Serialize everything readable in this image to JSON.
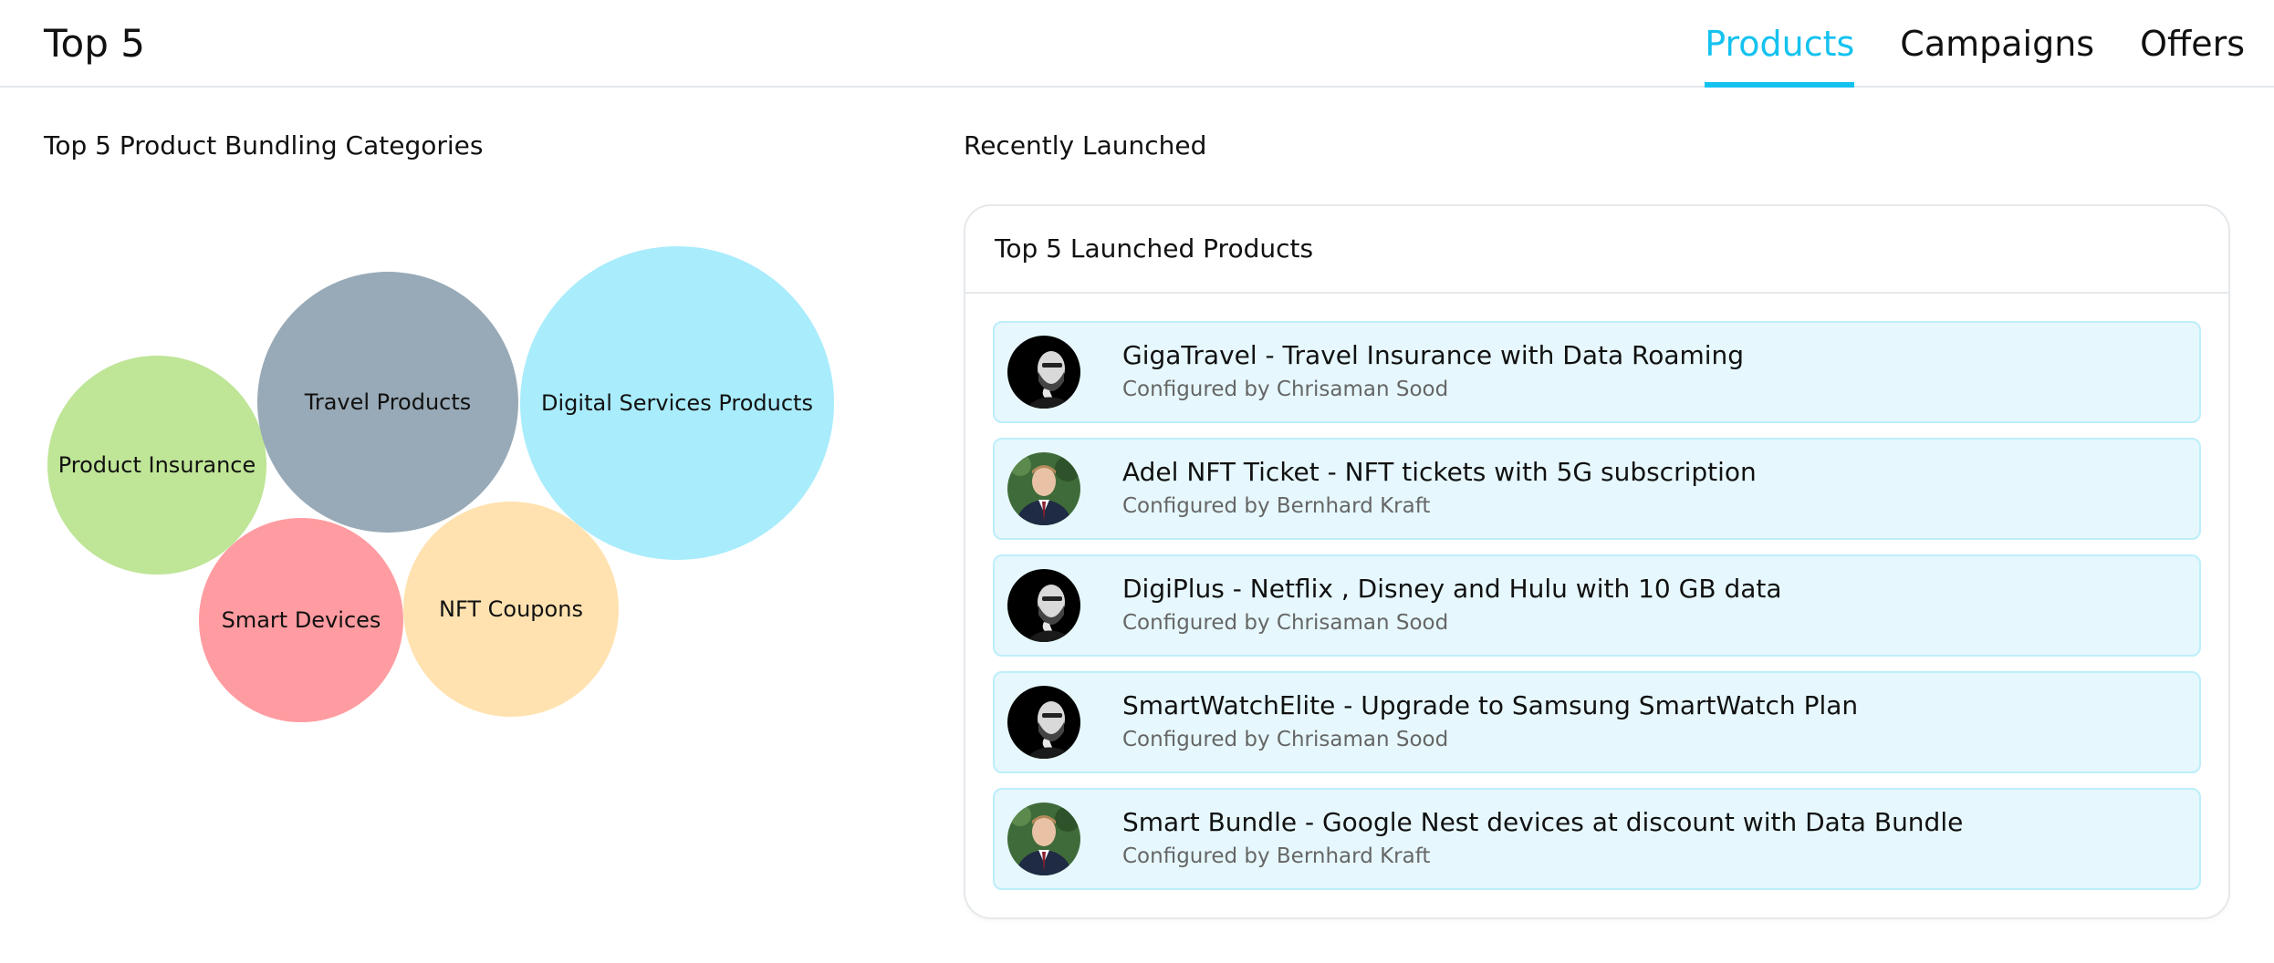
{
  "header": {
    "title": "Top 5",
    "tabs": [
      {
        "label": "Products",
        "active": true
      },
      {
        "label": "Campaigns",
        "active": false
      },
      {
        "label": "Offers",
        "active": false
      }
    ],
    "accent_color": "#14c2ef"
  },
  "bundling": {
    "heading": "Top 5 Product Bundling Categories",
    "categories": [
      {
        "label": "Product Insurance",
        "color": "#bfe597"
      },
      {
        "label": "Travel Products",
        "color": "#98aab7"
      },
      {
        "label": "Digital Services Products",
        "color": "#a9ecfc"
      },
      {
        "label": "Smart Devices",
        "color": "#ff9ca1"
      },
      {
        "label": "NFT Coupons",
        "color": "#ffe2b0"
      }
    ]
  },
  "recent": {
    "heading": "Recently Launched",
    "card_title": "Top 5 Launched Products",
    "items": [
      {
        "name": "GigaTravel - Travel Insurance with Data Roaming",
        "author": "Configured by Chrisaman Sood",
        "avatar": "bearded-man-avatar"
      },
      {
        "name": "Adel NFT Ticket - NFT tickets with 5G subscription",
        "author": "Configured by Bernhard Kraft",
        "avatar": "suit-man-avatar"
      },
      {
        "name": "DigiPlus - Netflix , Disney and Hulu with 10 GB data",
        "author": "Configured by Chrisaman Sood",
        "avatar": "bearded-man-avatar"
      },
      {
        "name": "SmartWatchElite - Upgrade to Samsung SmartWatch Plan",
        "author": "Configured by Chrisaman Sood",
        "avatar": "bearded-man-avatar"
      },
      {
        "name": "Smart Bundle - Google Nest devices at discount with Data Bundle",
        "author": "Configured by Bernhard Kraft",
        "avatar": "suit-man-avatar"
      }
    ]
  }
}
